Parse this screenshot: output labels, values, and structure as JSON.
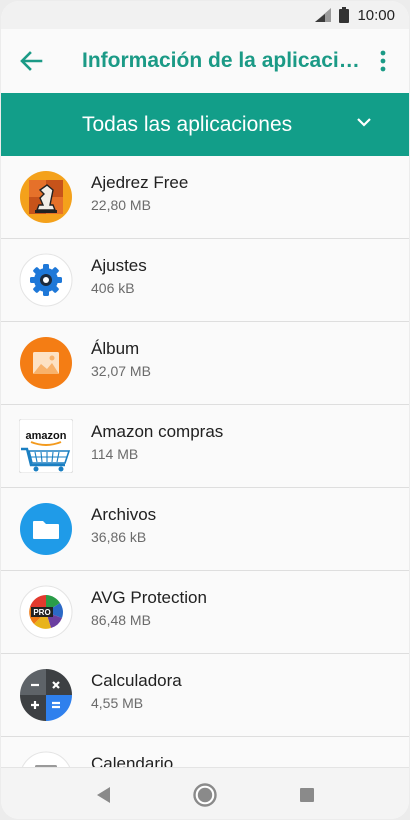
{
  "status_bar": {
    "time": "10:00"
  },
  "app_bar": {
    "title": "Información de la aplicaciones"
  },
  "filter": {
    "label": "Todas las aplicaciones"
  },
  "apps": [
    {
      "name": "Ajedrez Free",
      "size": "22,80 MB",
      "icon": "chess-icon"
    },
    {
      "name": "Ajustes",
      "size": "406 kB",
      "icon": "settings-gear-icon"
    },
    {
      "name": "Álbum",
      "size": "32,07 MB",
      "icon": "album-photo-icon"
    },
    {
      "name": "Amazon compras",
      "size": "114 MB",
      "icon": "amazon-cart-icon"
    },
    {
      "name": "Archivos",
      "size": "36,86 kB",
      "icon": "folder-icon"
    },
    {
      "name": "AVG Protection",
      "size": "86,48 MB",
      "icon": "avg-icon"
    },
    {
      "name": "Calculadora",
      "size": "4,55 MB",
      "icon": "calculator-icon"
    },
    {
      "name": "Calendario",
      "size": "",
      "icon": "calendar-icon"
    }
  ],
  "colors": {
    "accent": "#129e89",
    "title": "#1b9a86"
  }
}
